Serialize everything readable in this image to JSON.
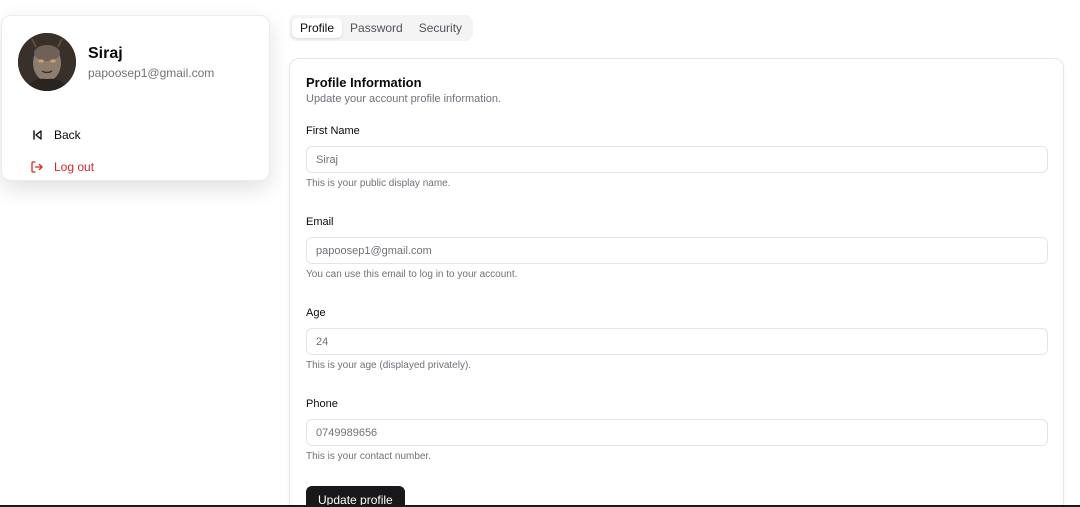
{
  "user": {
    "name": "Siraj",
    "email": "papoosep1@gmail.com"
  },
  "sidebar": {
    "back_label": "Back",
    "logout_label": "Log out",
    "back_icon": "step-back-icon",
    "logout_icon": "log-out-icon",
    "logout_color": "#dc2626"
  },
  "tabs": [
    {
      "label": "Profile",
      "active": true
    },
    {
      "label": "Password",
      "active": false
    },
    {
      "label": "Security",
      "active": false
    }
  ],
  "card": {
    "title": "Profile Information",
    "description": "Update your account profile information."
  },
  "fields": {
    "first_name": {
      "label": "First Name",
      "value": "Siraj",
      "help": "This is your public display name."
    },
    "email": {
      "label": "Email",
      "value": "papoosep1@gmail.com",
      "help": "You can use this email to log in to your account."
    },
    "age": {
      "label": "Age",
      "value": "24",
      "help": "This is your age (displayed privately)."
    },
    "phone": {
      "label": "Phone",
      "value": "0749989656",
      "help": "This is your contact number."
    }
  },
  "submit_label": "Update profile",
  "colors": {
    "primary_button": "#18181b",
    "muted_text": "#71717a"
  }
}
